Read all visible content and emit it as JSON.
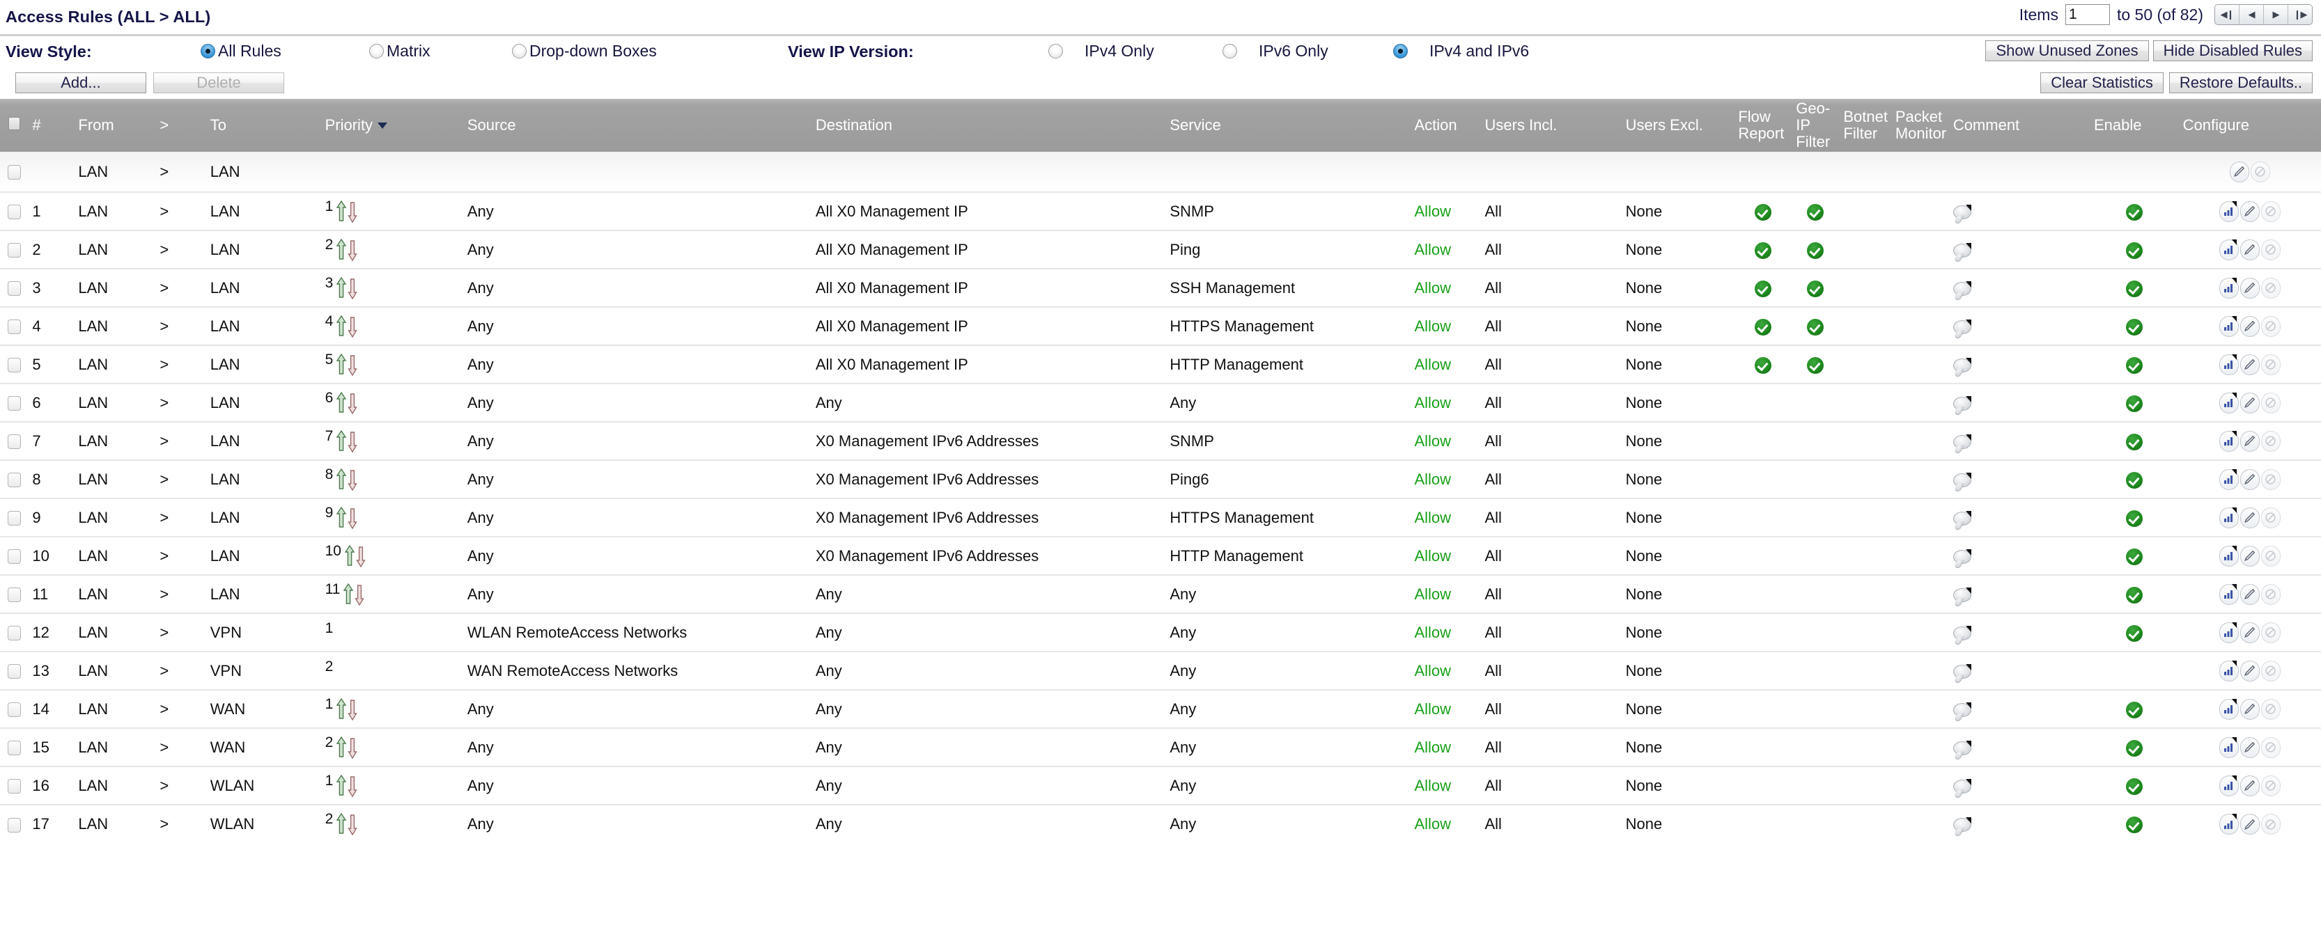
{
  "header": {
    "page_title": "Access Rules (ALL > ALL)",
    "pager": {
      "items_label": "Items",
      "items_value": "1",
      "range_label": "to 50 (of 82)",
      "nav": [
        {
          "name": "first-page",
          "glyph": "◀❙"
        },
        {
          "name": "prev-page",
          "glyph": "◀"
        },
        {
          "name": "next-page",
          "glyph": "▶"
        },
        {
          "name": "last-page",
          "glyph": "❙▶"
        }
      ]
    }
  },
  "view_style": {
    "label": "View Style:",
    "options": [
      {
        "label": "All Rules",
        "selected": true
      },
      {
        "label": "Matrix",
        "selected": false
      },
      {
        "label": "Drop-down Boxes",
        "selected": false
      }
    ]
  },
  "view_ip_version": {
    "label": "View IP Version:",
    "options": [
      {
        "label": "IPv4 Only",
        "selected": false
      },
      {
        "label": "IPv6 Only",
        "selected": false
      },
      {
        "label": "IPv4 and IPv6",
        "selected": true
      }
    ]
  },
  "buttons": {
    "show_unused_zones": "Show Unused Zones",
    "hide_disabled_rules": "Hide Disabled Rules",
    "add": "Add...",
    "delete": "Delete",
    "clear_statistics": "Clear Statistics",
    "restore_defaults": "Restore Defaults.."
  },
  "table": {
    "columns": [
      {
        "key": "check",
        "label": ""
      },
      {
        "key": "num",
        "label": "#"
      },
      {
        "key": "from",
        "label": "From"
      },
      {
        "key": "arrow",
        "label": ">"
      },
      {
        "key": "to",
        "label": "To"
      },
      {
        "key": "priority",
        "label": "Priority",
        "sorted": true
      },
      {
        "key": "source",
        "label": "Source"
      },
      {
        "key": "destination",
        "label": "Destination"
      },
      {
        "key": "service",
        "label": "Service"
      },
      {
        "key": "action",
        "label": "Action"
      },
      {
        "key": "users_incl",
        "label": "Users Incl."
      },
      {
        "key": "users_excl",
        "label": "Users Excl."
      },
      {
        "key": "flow_report",
        "label": "Flow Report"
      },
      {
        "key": "geo_ip_filter",
        "label": "Geo-IP Filter"
      },
      {
        "key": "botnet_filter",
        "label": "Botnet Filter"
      },
      {
        "key": "packet_monitor",
        "label": "Packet Monitor"
      },
      {
        "key": "comment",
        "label": "Comment"
      },
      {
        "key": "enable",
        "label": "Enable"
      },
      {
        "key": "configure",
        "label": "Configure"
      }
    ],
    "rows": [
      {
        "type": "zone",
        "num": "",
        "from": "LAN",
        "arrow": ">",
        "to": "LAN",
        "priority": "",
        "source": "",
        "destination": "",
        "service": "",
        "action": "",
        "users_incl": "",
        "users_excl": "",
        "flow_report": false,
        "geo_ip_filter": false,
        "comment": false,
        "enable": false,
        "configure": [
          "edit",
          "disable"
        ]
      },
      {
        "type": "rule",
        "num": "1",
        "from": "LAN",
        "arrow": ">",
        "to": "LAN",
        "priority": "1",
        "arrows": true,
        "source": "Any",
        "destination": "All X0 Management IP",
        "service": "SNMP",
        "action": "Allow",
        "users_incl": "All",
        "users_excl": "None",
        "flow_report": true,
        "geo_ip_filter": true,
        "comment": true,
        "enable": true,
        "configure": [
          "stats",
          "edit",
          "disable"
        ]
      },
      {
        "type": "rule",
        "num": "2",
        "from": "LAN",
        "arrow": ">",
        "to": "LAN",
        "priority": "2",
        "arrows": true,
        "source": "Any",
        "destination": "All X0 Management IP",
        "service": "Ping",
        "action": "Allow",
        "users_incl": "All",
        "users_excl": "None",
        "flow_report": true,
        "geo_ip_filter": true,
        "comment": true,
        "enable": true,
        "configure": [
          "stats",
          "edit",
          "disable"
        ]
      },
      {
        "type": "rule",
        "num": "3",
        "from": "LAN",
        "arrow": ">",
        "to": "LAN",
        "priority": "3",
        "arrows": true,
        "source": "Any",
        "destination": "All X0 Management IP",
        "service": "SSH Management",
        "action": "Allow",
        "users_incl": "All",
        "users_excl": "None",
        "flow_report": true,
        "geo_ip_filter": true,
        "comment": true,
        "enable": true,
        "configure": [
          "stats",
          "edit",
          "disable"
        ]
      },
      {
        "type": "rule",
        "num": "4",
        "from": "LAN",
        "arrow": ">",
        "to": "LAN",
        "priority": "4",
        "arrows": true,
        "source": "Any",
        "destination": "All X0 Management IP",
        "service": "HTTPS Management",
        "action": "Allow",
        "users_incl": "All",
        "users_excl": "None",
        "flow_report": true,
        "geo_ip_filter": true,
        "comment": true,
        "enable": true,
        "configure": [
          "stats",
          "edit",
          "disable"
        ]
      },
      {
        "type": "rule",
        "num": "5",
        "from": "LAN",
        "arrow": ">",
        "to": "LAN",
        "priority": "5",
        "arrows": true,
        "source": "Any",
        "destination": "All X0 Management IP",
        "service": "HTTP Management",
        "action": "Allow",
        "users_incl": "All",
        "users_excl": "None",
        "flow_report": true,
        "geo_ip_filter": true,
        "comment": true,
        "enable": true,
        "configure": [
          "stats",
          "edit",
          "disable"
        ]
      },
      {
        "type": "rule",
        "num": "6",
        "from": "LAN",
        "arrow": ">",
        "to": "LAN",
        "priority": "6",
        "arrows": true,
        "source": "Any",
        "destination": "Any",
        "service": "Any",
        "action": "Allow",
        "users_incl": "All",
        "users_excl": "None",
        "flow_report": false,
        "geo_ip_filter": false,
        "comment": true,
        "enable": true,
        "configure": [
          "stats",
          "edit",
          "disable"
        ]
      },
      {
        "type": "rule",
        "num": "7",
        "from": "LAN",
        "arrow": ">",
        "to": "LAN",
        "priority": "7",
        "arrows": true,
        "source": "Any",
        "destination": "X0 Management IPv6 Addresses",
        "service": "SNMP",
        "action": "Allow",
        "users_incl": "All",
        "users_excl": "None",
        "flow_report": false,
        "geo_ip_filter": false,
        "comment": true,
        "enable": true,
        "configure": [
          "stats",
          "edit",
          "disable"
        ]
      },
      {
        "type": "rule",
        "num": "8",
        "from": "LAN",
        "arrow": ">",
        "to": "LAN",
        "priority": "8",
        "arrows": true,
        "source": "Any",
        "destination": "X0 Management IPv6 Addresses",
        "service": "Ping6",
        "action": "Allow",
        "users_incl": "All",
        "users_excl": "None",
        "flow_report": false,
        "geo_ip_filter": false,
        "comment": true,
        "enable": true,
        "configure": [
          "stats",
          "edit",
          "disable"
        ]
      },
      {
        "type": "rule",
        "num": "9",
        "from": "LAN",
        "arrow": ">",
        "to": "LAN",
        "priority": "9",
        "arrows": true,
        "source": "Any",
        "destination": "X0 Management IPv6 Addresses",
        "service": "HTTPS Management",
        "action": "Allow",
        "users_incl": "All",
        "users_excl": "None",
        "flow_report": false,
        "geo_ip_filter": false,
        "comment": true,
        "enable": true,
        "configure": [
          "stats",
          "edit",
          "disable"
        ]
      },
      {
        "type": "rule",
        "num": "10",
        "from": "LAN",
        "arrow": ">",
        "to": "LAN",
        "priority": "10",
        "arrows": true,
        "source": "Any",
        "destination": "X0 Management IPv6 Addresses",
        "service": "HTTP Management",
        "action": "Allow",
        "users_incl": "All",
        "users_excl": "None",
        "flow_report": false,
        "geo_ip_filter": false,
        "comment": true,
        "enable": true,
        "configure": [
          "stats",
          "edit",
          "disable"
        ]
      },
      {
        "type": "rule",
        "num": "11",
        "from": "LAN",
        "arrow": ">",
        "to": "LAN",
        "priority": "11",
        "arrows": true,
        "source": "Any",
        "destination": "Any",
        "service": "Any",
        "action": "Allow",
        "users_incl": "All",
        "users_excl": "None",
        "flow_report": false,
        "geo_ip_filter": false,
        "comment": true,
        "enable": true,
        "configure": [
          "stats",
          "edit",
          "disable"
        ]
      },
      {
        "type": "rule",
        "num": "12",
        "from": "LAN",
        "arrow": ">",
        "to": "VPN",
        "priority": "1",
        "arrows": false,
        "source": "WLAN RemoteAccess Networks",
        "destination": "Any",
        "service": "Any",
        "action": "Allow",
        "users_incl": "All",
        "users_excl": "None",
        "flow_report": false,
        "geo_ip_filter": false,
        "comment": true,
        "enable": true,
        "configure": [
          "stats",
          "edit",
          "disable"
        ]
      },
      {
        "type": "rule",
        "num": "13",
        "from": "LAN",
        "arrow": ">",
        "to": "VPN",
        "priority": "2",
        "arrows": false,
        "source": "WAN RemoteAccess Networks",
        "destination": "Any",
        "service": "Any",
        "action": "Allow",
        "users_incl": "All",
        "users_excl": "None",
        "flow_report": false,
        "geo_ip_filter": false,
        "comment": true,
        "enable": false,
        "configure": [
          "stats",
          "edit",
          "disable"
        ]
      },
      {
        "type": "rule",
        "num": "14",
        "from": "LAN",
        "arrow": ">",
        "to": "WAN",
        "priority": "1",
        "arrows": true,
        "source": "Any",
        "destination": "Any",
        "service": "Any",
        "action": "Allow",
        "users_incl": "All",
        "users_excl": "None",
        "flow_report": false,
        "geo_ip_filter": false,
        "comment": true,
        "enable": true,
        "configure": [
          "stats",
          "edit",
          "disable"
        ]
      },
      {
        "type": "rule",
        "num": "15",
        "from": "LAN",
        "arrow": ">",
        "to": "WAN",
        "priority": "2",
        "arrows": true,
        "source": "Any",
        "destination": "Any",
        "service": "Any",
        "action": "Allow",
        "users_incl": "All",
        "users_excl": "None",
        "flow_report": false,
        "geo_ip_filter": false,
        "comment": true,
        "enable": true,
        "configure": [
          "stats",
          "edit",
          "disable"
        ]
      },
      {
        "type": "rule",
        "num": "16",
        "from": "LAN",
        "arrow": ">",
        "to": "WLAN",
        "priority": "1",
        "arrows": true,
        "source": "Any",
        "destination": "Any",
        "service": "Any",
        "action": "Allow",
        "users_incl": "All",
        "users_excl": "None",
        "flow_report": false,
        "geo_ip_filter": false,
        "comment": true,
        "enable": true,
        "configure": [
          "stats",
          "edit",
          "disable"
        ]
      },
      {
        "type": "rule",
        "num": "17",
        "from": "LAN",
        "arrow": ">",
        "to": "WLAN",
        "priority": "2",
        "arrows": true,
        "source": "Any",
        "destination": "Any",
        "service": "Any",
        "action": "Allow",
        "users_incl": "All",
        "users_excl": "None",
        "flow_report": false,
        "geo_ip_filter": false,
        "comment": true,
        "enable": true,
        "configure": [
          "stats",
          "edit",
          "disable"
        ]
      }
    ]
  },
  "colors": {
    "accent": "#15154a",
    "allow_green": "#18a018",
    "check_green": "#1f8a1f",
    "header_gray": "#9b9b9b"
  }
}
